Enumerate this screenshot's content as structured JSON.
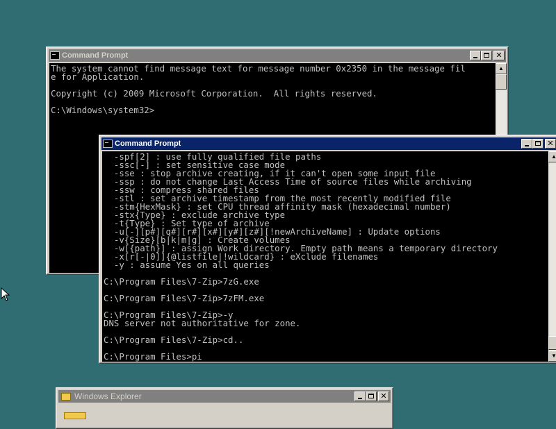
{
  "windows": {
    "back_cmd": {
      "title": "Command Prompt",
      "lines": [
        "The system cannot find message text for message number 0x2350 in the message fil",
        "e for Application.",
        "",
        "Copyright (c) 2009 Microsoft Corporation.  All rights reserved.",
        "",
        "C:\\Windows\\system32>"
      ]
    },
    "front_cmd": {
      "title": "Command Prompt",
      "lines": [
        "  -spf[2] : use fully qualified file paths",
        "  -ssc[-] : set sensitive case mode",
        "  -sse : stop archive creating, if it can't open some input file",
        "  -ssp : do not change Last Access Time of source files while archiving",
        "  -ssw : compress shared files",
        "  -stl : set archive timestamp from the most recently modified file",
        "  -stm{HexMask} : set CPU thread affinity mask (hexadecimal number)",
        "  -stx{Type} : exclude archive type",
        "  -t{Type} : Set type of archive",
        "  -u[-][p#][q#][r#][x#][y#][z#][!newArchiveName] : Update options",
        "  -v{Size}[b|k|m|g] : Create volumes",
        "  -w[{path}] : assign Work directory. Empty path means a temporary directory",
        "  -x[r[-|0]]{@listfile|!wildcard} : eXclude filenames",
        "  -y : assume Yes on all queries",
        "",
        "C:\\Program Files\\7-Zip>7zG.exe",
        "",
        "C:\\Program Files\\7-Zip>7zFM.exe",
        "",
        "C:\\Program Files\\7-Zip>-y",
        "DNS server not authoritative for zone.",
        "",
        "C:\\Program Files\\7-Zip>cd..",
        "",
        "C:\\Program Files>pi"
      ]
    },
    "explorer": {
      "title": "Windows Explorer"
    }
  },
  "icons": {
    "minimize": "minimize-icon",
    "maximize": "maximize-icon",
    "close": "close-icon",
    "close_glyph": "✕",
    "up_arrow": "▲",
    "down_arrow": "▼"
  },
  "colors": {
    "desktop": "#2f6d72",
    "active_title": "#0a246a",
    "inactive_title": "#808080",
    "console_bg": "#000000",
    "console_text": "#c0c0c0"
  }
}
